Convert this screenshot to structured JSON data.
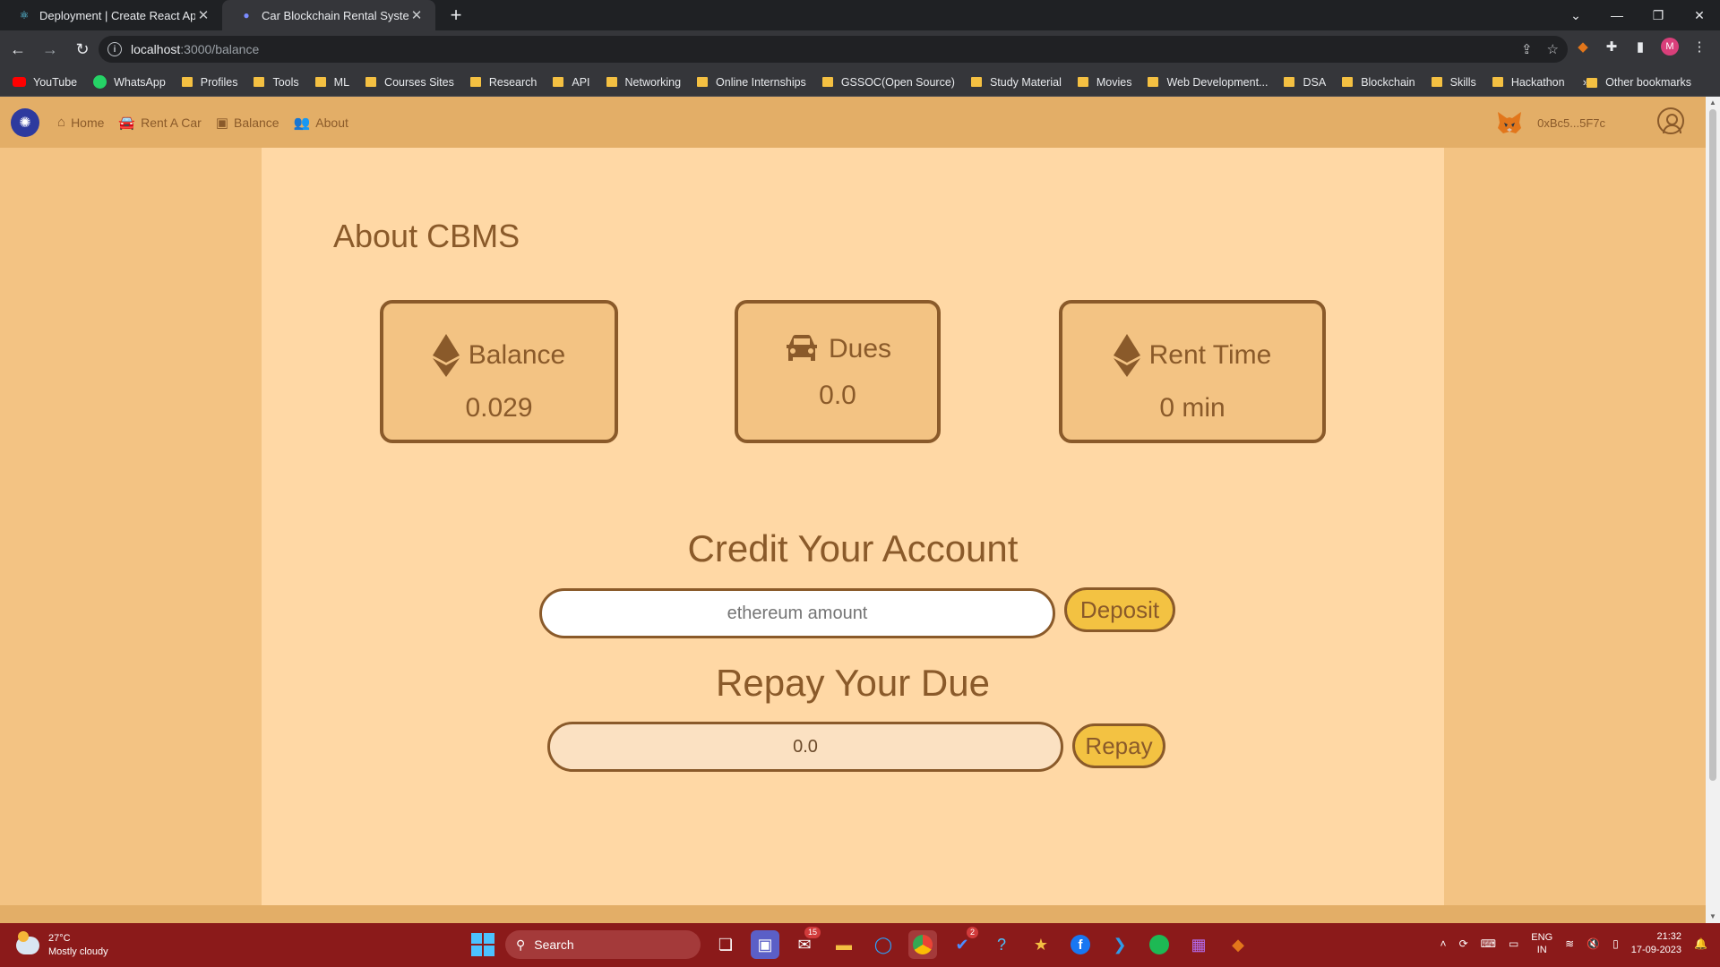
{
  "browser": {
    "tabs": [
      {
        "title": "Deployment | Create React App",
        "icon": "react-icon"
      },
      {
        "title": "Car Blockchain Rental System",
        "icon": "cbms-icon"
      }
    ],
    "address": {
      "host": "localhost",
      "path": ":3000/balance"
    },
    "bookmarks": [
      {
        "label": "YouTube",
        "icon": "youtube-icon"
      },
      {
        "label": "WhatsApp",
        "icon": "whatsapp-icon"
      },
      {
        "label": "Profiles",
        "icon": "folder-icon"
      },
      {
        "label": "Tools",
        "icon": "folder-icon"
      },
      {
        "label": "ML",
        "icon": "folder-icon"
      },
      {
        "label": "Courses Sites",
        "icon": "folder-icon"
      },
      {
        "label": "Research",
        "icon": "folder-icon"
      },
      {
        "label": "API",
        "icon": "folder-icon"
      },
      {
        "label": "Networking",
        "icon": "folder-icon"
      },
      {
        "label": "Online Internships",
        "icon": "folder-icon"
      },
      {
        "label": "GSSOC(Open Source)",
        "icon": "folder-icon"
      },
      {
        "label": "Study Material",
        "icon": "folder-icon"
      },
      {
        "label": "Movies",
        "icon": "folder-icon"
      },
      {
        "label": "Web Development...",
        "icon": "folder-icon"
      },
      {
        "label": "DSA",
        "icon": "folder-icon"
      },
      {
        "label": "Blockchain",
        "icon": "folder-icon"
      },
      {
        "label": "Skills",
        "icon": "folder-icon"
      },
      {
        "label": "Hackathon",
        "icon": "folder-icon"
      }
    ],
    "more_bookmarks": "»",
    "other_bookmarks": "Other bookmarks",
    "profile_initial": "M"
  },
  "app": {
    "nav": {
      "home": "Home",
      "rent": "Rent A Car",
      "balance": "Balance",
      "about": "About"
    },
    "wallet_address": "0xBc5...5F7c",
    "page_title": "About CBMS",
    "cards": {
      "balance": {
        "label": "Balance",
        "value": "0.029"
      },
      "dues": {
        "label": "Dues",
        "value": "0.0"
      },
      "rent_time": {
        "label": "Rent Time",
        "value": "0 min"
      }
    },
    "credit": {
      "title": "Credit Your Account",
      "placeholder": "ethereum amount",
      "button": "Deposit"
    },
    "repay": {
      "title": "Repay Your Due",
      "value": "0.0",
      "button": "Repay"
    },
    "colors": {
      "nav_bg": "#e3ae67",
      "page_bg": "#f3c383",
      "panel_bg": "#ffd8a5",
      "accent_brown": "#8a5a2a",
      "button_yellow": "#f3c242"
    }
  },
  "taskbar": {
    "weather_temp": "27°C",
    "weather_desc": "Mostly cloudy",
    "search_label": "Search",
    "mail_badge": "15",
    "todo_badge": "2",
    "lang_top": "ENG",
    "lang_bottom": "IN",
    "time": "21:32",
    "date": "17-09-2023"
  }
}
